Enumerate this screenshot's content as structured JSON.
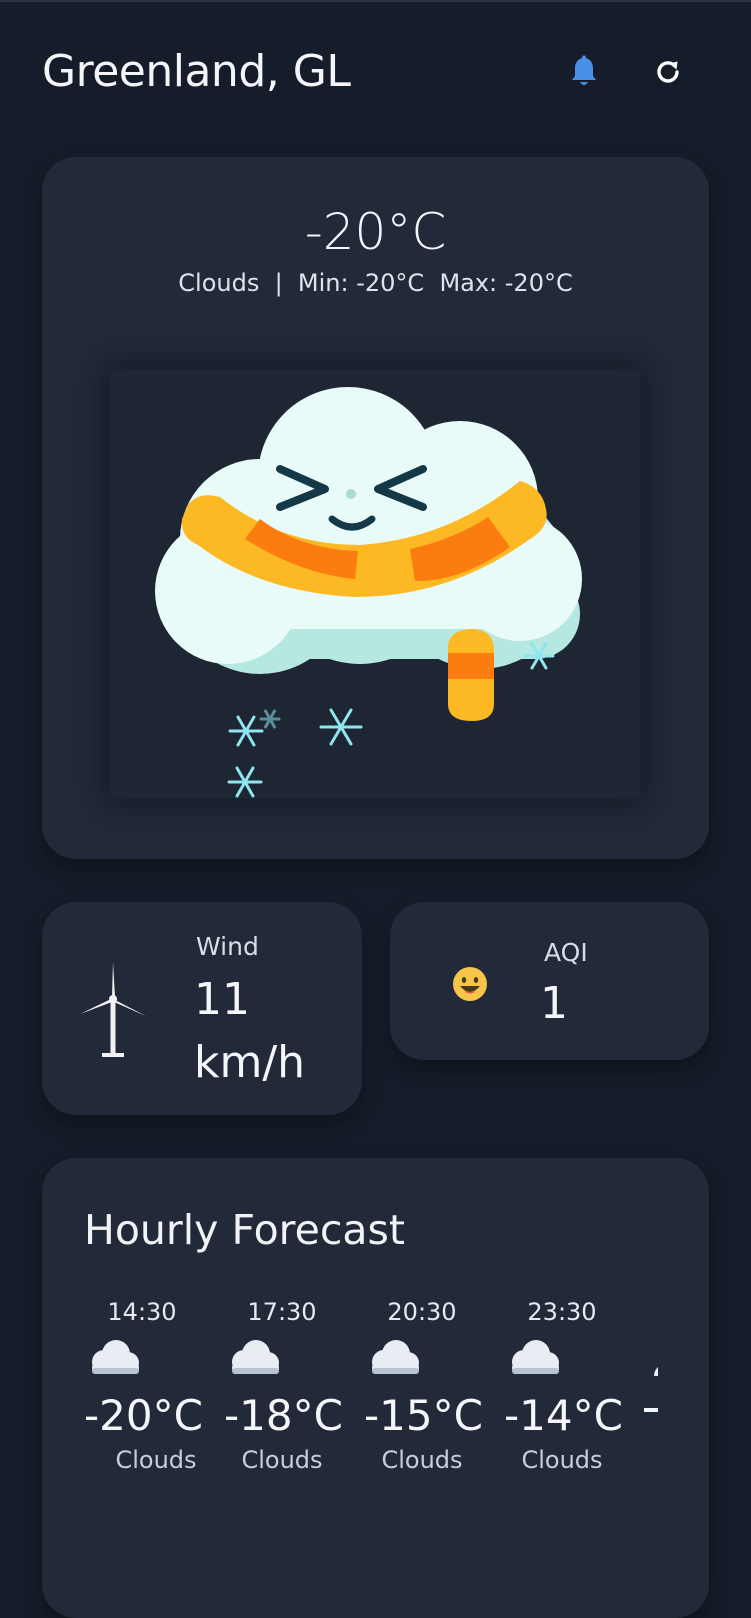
{
  "header": {
    "city": "Greenland, GL",
    "icons": [
      "bell-icon",
      "refresh-icon"
    ],
    "accent_color": "#4a8fe8"
  },
  "current": {
    "temperature": "-20°C",
    "summary": "Clouds  |  Min: -20°C  Max: -20°C",
    "illustration": "cloud-with-scarf-snowing"
  },
  "wind": {
    "label": "Wind",
    "value": "11 km/h",
    "icon": "wind-turbine-icon"
  },
  "aqi": {
    "label": "AQI",
    "value": "1",
    "icon": "smiling-face-icon"
  },
  "hourly": {
    "title": "Hourly Forecast",
    "items": [
      {
        "time": "14:30",
        "temp": "-20°C",
        "condition": "Clouds"
      },
      {
        "time": "17:30",
        "temp": "-18°C",
        "condition": "Clouds"
      },
      {
        "time": "20:30",
        "temp": "-15°C",
        "condition": "Clouds"
      },
      {
        "time": "23:30",
        "temp": "-14°C",
        "condition": "Clouds"
      }
    ]
  }
}
